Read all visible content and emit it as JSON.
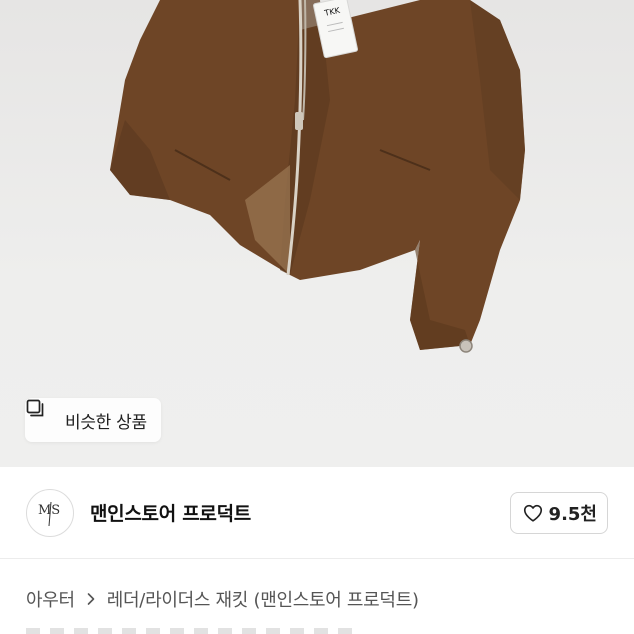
{
  "product": {
    "image_icon": "jacket-photo",
    "tag_text": "TKK",
    "similar_label": "비슷한 상품",
    "similar_icon": "similar-items-icon"
  },
  "shop": {
    "avatar_text": "MS",
    "name": "맨인스토어 프로덕트",
    "likes": "9.5천",
    "like_icon": "heart-outline-icon"
  },
  "breadcrumb": {
    "category": "아우터",
    "subcategory": "레더/라이더스 재킷 (맨인스토어 프로덕트)",
    "separator_icon": "chevron-right-icon"
  },
  "colors": {
    "jacket": "#6b4424",
    "background": "#ededec",
    "accent": "#111111"
  }
}
